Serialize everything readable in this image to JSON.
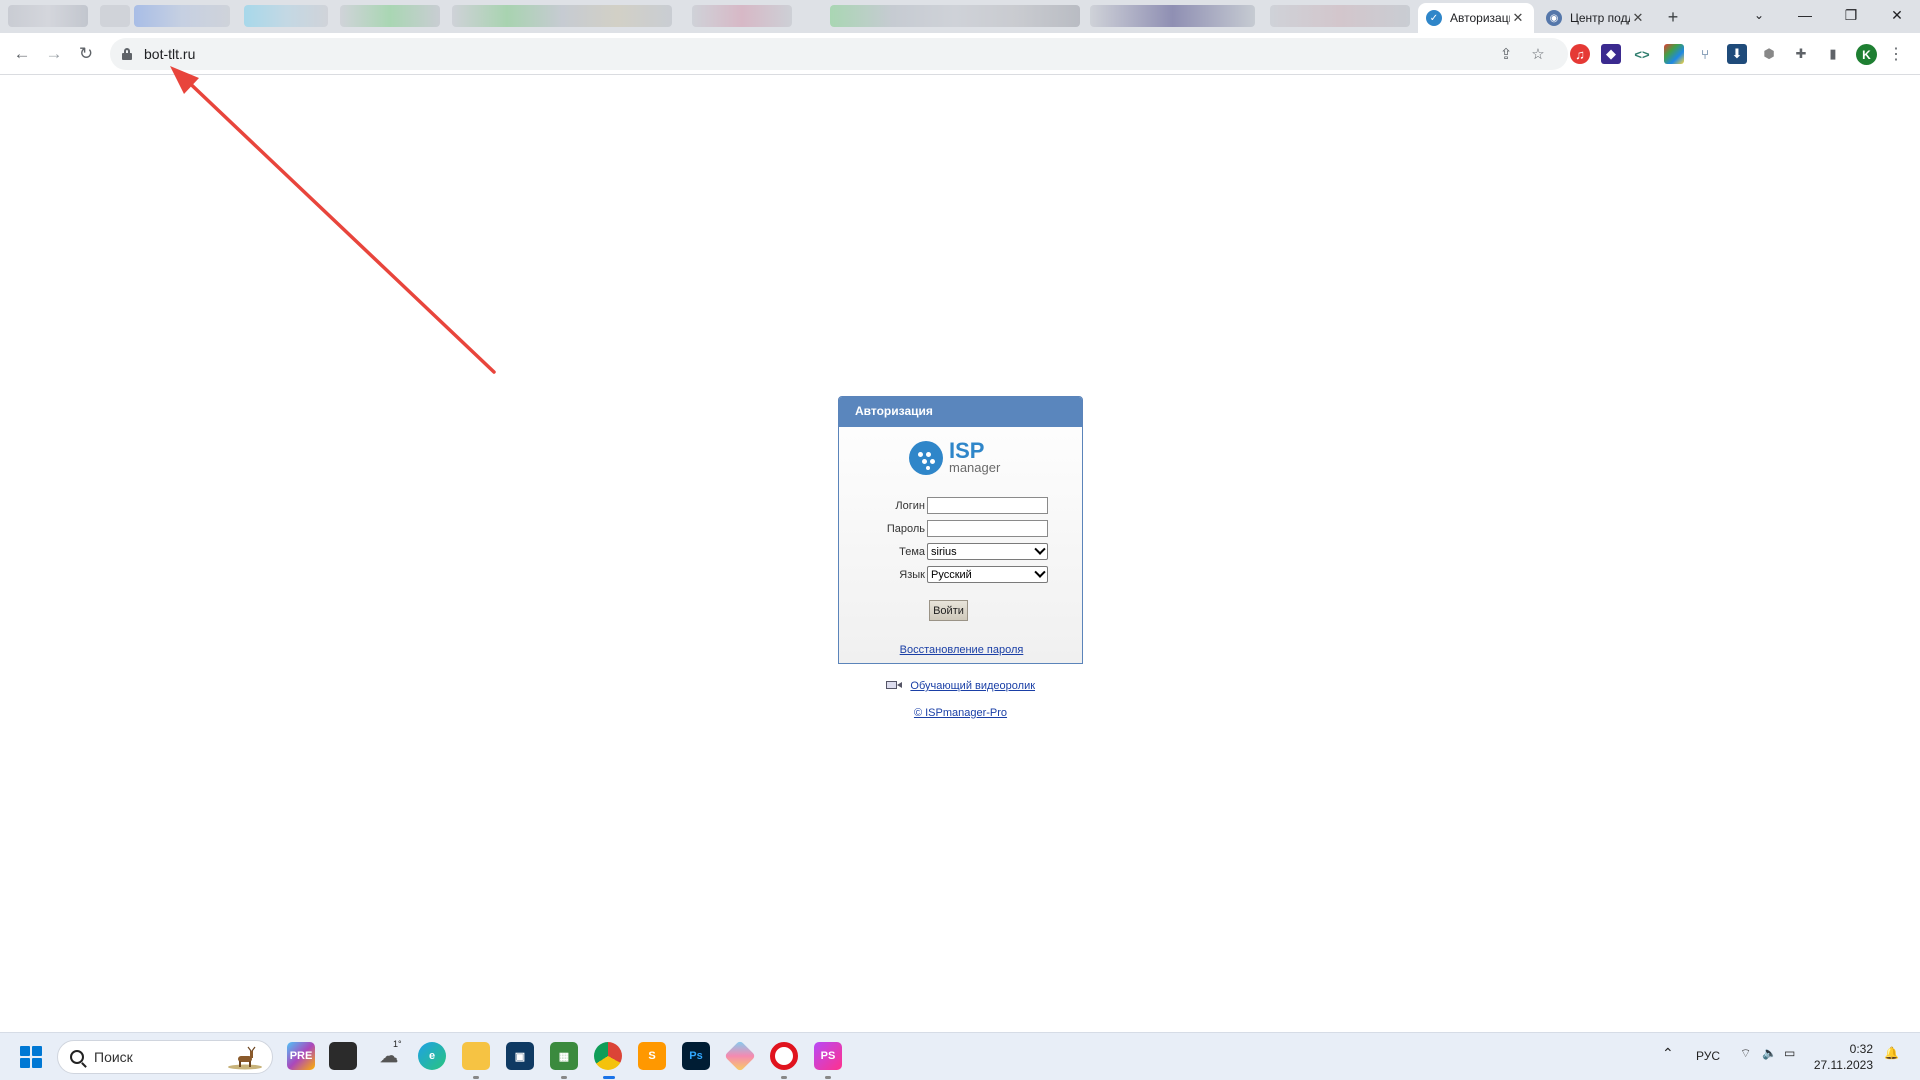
{
  "browser": {
    "active_tab": {
      "title": "Авторизация",
      "favicon": "check-circle-icon"
    },
    "second_tab": {
      "title": "Центр поддержки",
      "favicon": "globe-icon"
    },
    "new_tab_label": "+",
    "url": "bot-tlt.ru"
  },
  "login": {
    "header": "Авторизация",
    "logo_isp": "ISP",
    "logo_manager": "manager",
    "login_label": "Логин",
    "login_value": "",
    "password_label": "Пароль",
    "password_value": "",
    "theme_label": "Тема",
    "theme_value": "sirius",
    "language_label": "Язык",
    "language_value": "Русский",
    "submit_label": "Войти",
    "recover_link": "Восстановление пароля",
    "video_link": "Обучающий видеоролик",
    "copyright_link": "© ISPmanager-Pro"
  },
  "taskbar": {
    "search_placeholder": "Поиск",
    "language": "РУС",
    "time": "0:32",
    "date": "27.11.2023",
    "weather_temp": "1°"
  },
  "colors": {
    "panel_header": "#5a86bd",
    "link": "#1a3fa6",
    "arrow": "#e8453c",
    "isp_blue": "#2f86c9"
  }
}
